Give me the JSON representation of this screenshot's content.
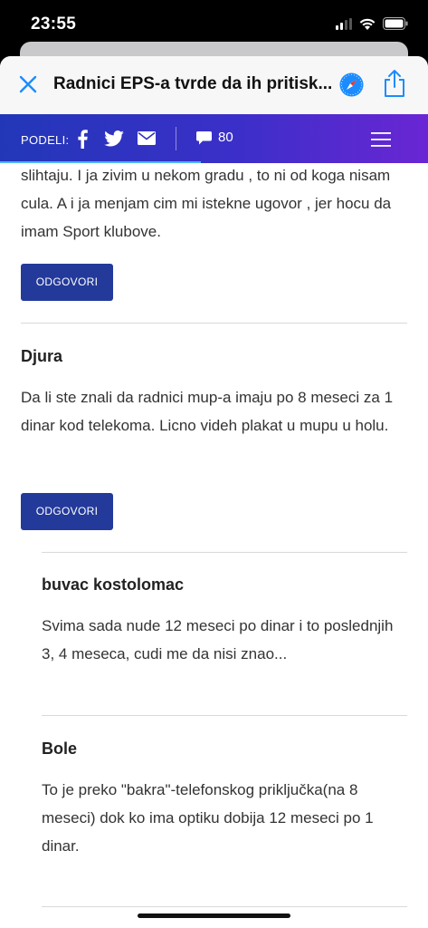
{
  "status_bar": {
    "time": "23:55"
  },
  "nav": {
    "title": "Radnici EPS-a tvrde da ih pritisk..."
  },
  "share_bar": {
    "label": "PODELI:",
    "comment_count": "80"
  },
  "comments": [
    {
      "text": "slihtaju. I ja zivim u nekom gradu , to ni od koga nisam cula. A i ja menjam cim mi istekne ugovor , jer hocu da imam Sport klubove.",
      "reply_label": "ODGOVORI"
    },
    {
      "author": "Djura",
      "text": "Da li ste znali da radnici mup-a imaju po 8 meseci za 1 dinar kod telekoma. Licno videh plakat u mupu u holu.",
      "reply_label": "ODGOVORI"
    },
    {
      "author": "buvac kostolomac",
      "text": "Svima sada nude 12 meseci po dinar i to poslednjih 3, 4 meseca, cudi me da nisi znao..."
    },
    {
      "author": "Bole",
      "text": "To je preko \"bakra\"-telefonskog priključka(na 8 meseci) dok ko ima optiku dobija 12 meseci po 1 dinar."
    }
  ],
  "colors": {
    "accent": "#233a9a",
    "share_gradient_start": "#2237b8",
    "share_gradient_end": "#6a26d4",
    "link_blue": "#1a8cff"
  }
}
